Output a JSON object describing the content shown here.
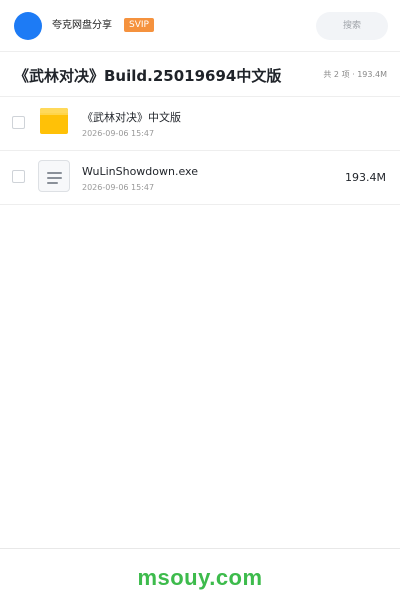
{
  "header": {
    "app_name": "夸克网盘分享",
    "badge": "SVIP",
    "search_placeholder": "搜索"
  },
  "share": {
    "title": "《武林对决》Build.25019694中文版",
    "summary": "共 2 项 · 193.4M"
  },
  "files": [
    {
      "name": "《武林对决》中文版",
      "date": "2026-09-06 15:47",
      "size": "",
      "type": "folder-icon"
    },
    {
      "name": "WuLinShowdown.exe",
      "date": "2026-09-06 15:47",
      "size": "193.4M",
      "type": "file-icon"
    }
  ],
  "footer": {
    "watermark": "msouy.com"
  },
  "colors": {
    "accent": "#1d7bf5",
    "svip": "#f5923e",
    "folder": "#ffc107",
    "watermark": "#3dbb4c"
  }
}
